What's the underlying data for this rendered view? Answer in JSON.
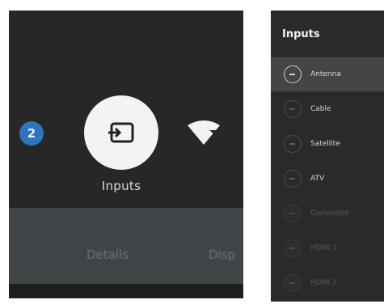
{
  "left": {
    "badge_count": "2",
    "inputs_label": "Inputs",
    "menu": {
      "details_label": "Details",
      "more_label": "Disp"
    }
  },
  "right": {
    "title": "Inputs",
    "items": [
      {
        "label": "Antenna",
        "state": "selected"
      },
      {
        "label": "Cable",
        "state": "normal"
      },
      {
        "label": "Satellite",
        "state": "normal"
      },
      {
        "label": "ATV",
        "state": "normal"
      },
      {
        "label": "Composite",
        "state": "dim"
      },
      {
        "label": "HDMI 1",
        "state": "dim"
      },
      {
        "label": "HDMI 2",
        "state": "dim"
      }
    ]
  },
  "colors": {
    "badge": "#2f74be",
    "panel_bg": "#272727",
    "menu_bar": "#3f4447",
    "selected_row": "#454545"
  }
}
